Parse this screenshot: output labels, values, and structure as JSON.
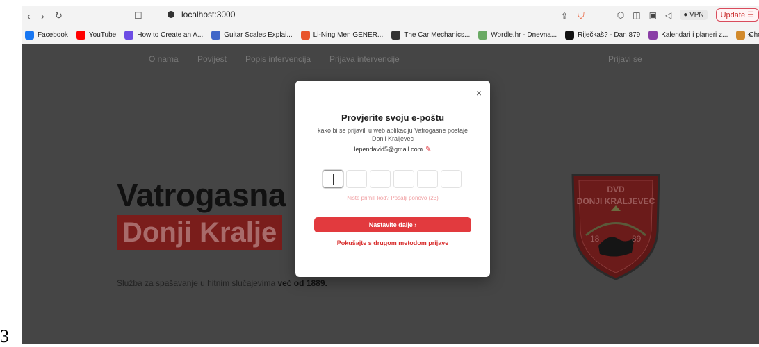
{
  "left_marker": "3",
  "browser": {
    "address": "localhost:3000",
    "vpn_label": "VPN",
    "update_label": "Update",
    "bookmarks": [
      {
        "label": "Facebook",
        "color": "#1877f2"
      },
      {
        "label": "YouTube",
        "color": "#ff0000"
      },
      {
        "label": "How to Create an A...",
        "color": "#6c4ce4"
      },
      {
        "label": "Guitar Scales Explai...",
        "color": "#3f66c8"
      },
      {
        "label": "Li-Ning Men GENER...",
        "color": "#e8542b"
      },
      {
        "label": "The Car Mechanics...",
        "color": "#333333"
      },
      {
        "label": "Wordle.hr - Dnevna...",
        "color": "#6aaa64"
      },
      {
        "label": "Riječkaš? - Dan 879",
        "color": "#111111"
      },
      {
        "label": "Kalendari i planeri z...",
        "color": "#8a3ea6"
      },
      {
        "label": "Chogan parfemi za...",
        "color": "#d28a2c"
      }
    ],
    "more": "»"
  },
  "nav": {
    "items": [
      "O nama",
      "Povijest",
      "Popis intervencija",
      "Prijava intervencije"
    ],
    "login": "Prijavi se"
  },
  "hero": {
    "line1": "Vatrogasna",
    "line2": "Donji Kralje",
    "tagline_prefix": "Služba za spašavanje u hitnim slučajevima ",
    "tagline_bold": "već od 1889."
  },
  "crest": {
    "top_text": "DVD",
    "name": "DONJI KRALJEVEC",
    "year_left": "18",
    "year_right": "89"
  },
  "modal": {
    "close": "×",
    "title": "Provjerite svoju e-poštu",
    "subtitle": "kako bi se prijavili u web aplikaciju Vatrogasne postaje Donji Kraljevec",
    "email": "lependavid5@gmail.com",
    "code_boxes": 6,
    "resend": "Niste primili kod? Pošalji ponovo (23)",
    "continue": "Nastavite dalje",
    "continue_arrow": "›",
    "alt_method": "Pokušajte s drugom metodom prijave"
  },
  "colors": {
    "accent": "#e23a3e",
    "overlay": "#454545",
    "hero_band": "#7a1d1b"
  }
}
